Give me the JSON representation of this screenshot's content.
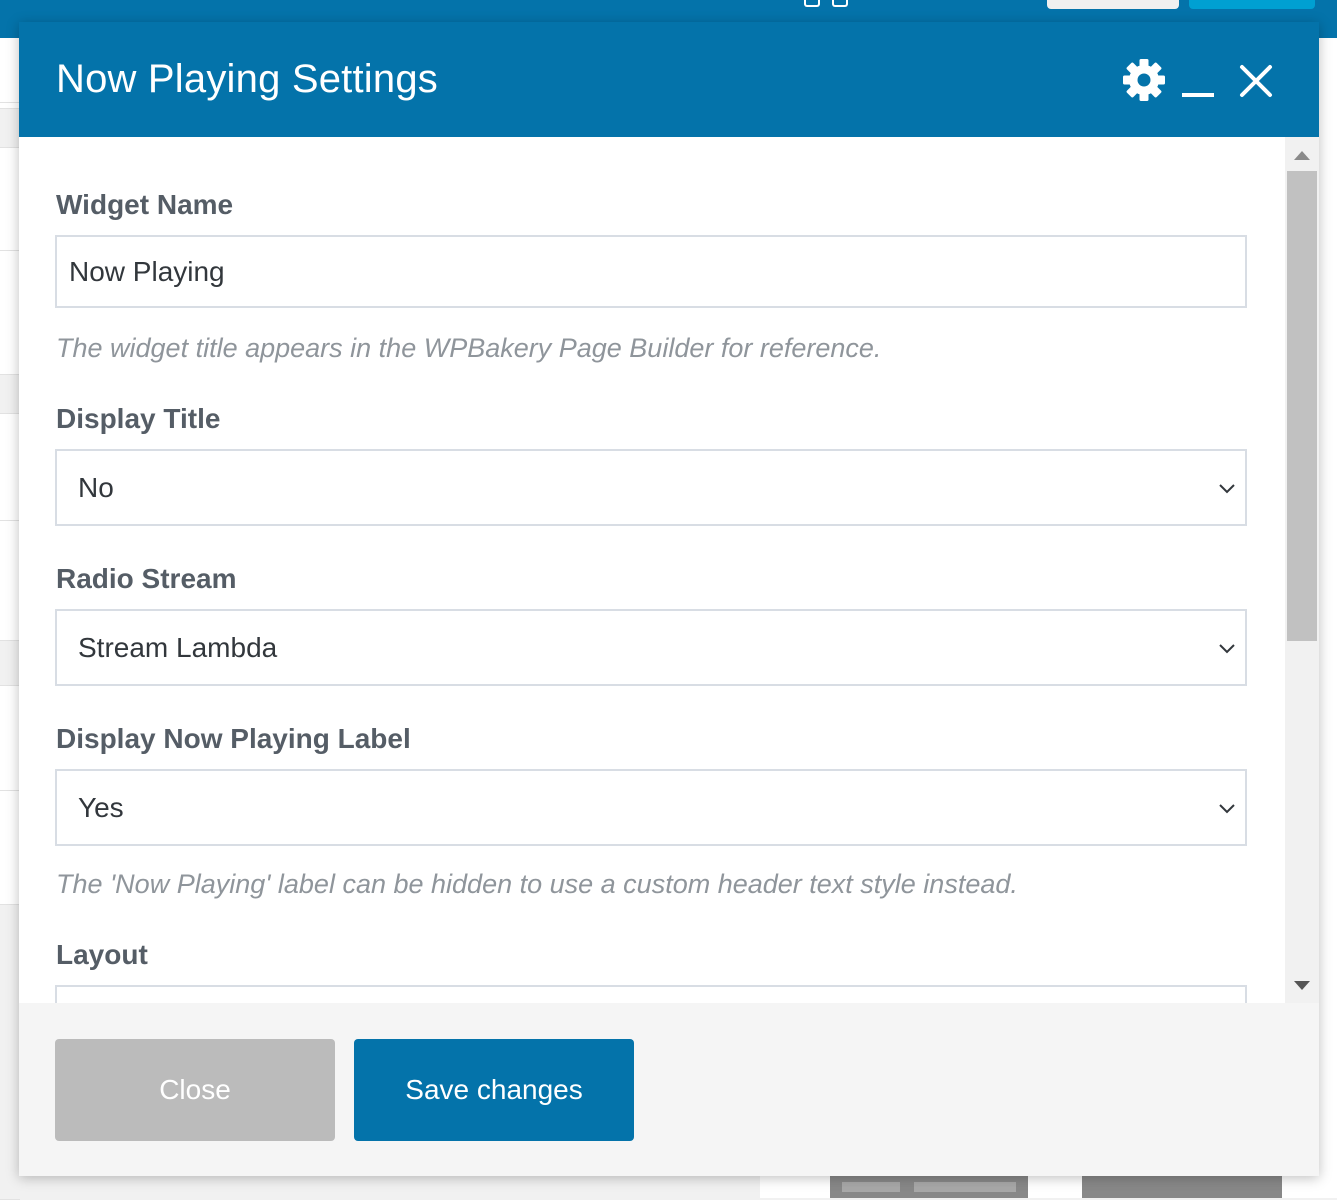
{
  "modal": {
    "title": "Now Playing Settings",
    "header_icons": [
      "gear-icon",
      "minimize-icon",
      "close-icon"
    ]
  },
  "fields": {
    "widget_name": {
      "label": "Widget Name",
      "value": "Now Playing",
      "help": "The widget title appears in the WPBakery Page Builder for reference."
    },
    "display_title": {
      "label": "Display Title",
      "value": "No"
    },
    "radio_stream": {
      "label": "Radio Stream",
      "value": "Stream Lambda"
    },
    "display_now_playing_label": {
      "label": "Display Now Playing Label",
      "value": "Yes",
      "help": "The 'Now Playing' label can be hidden to use a custom header text style instead."
    },
    "layout": {
      "label": "Layout"
    }
  },
  "footer": {
    "close_label": "Close",
    "save_label": "Save changes"
  },
  "colors": {
    "primary": "#0473aa",
    "close_button": "#bbbbbb",
    "label_text": "#555d66",
    "help_text": "#8f959b"
  }
}
